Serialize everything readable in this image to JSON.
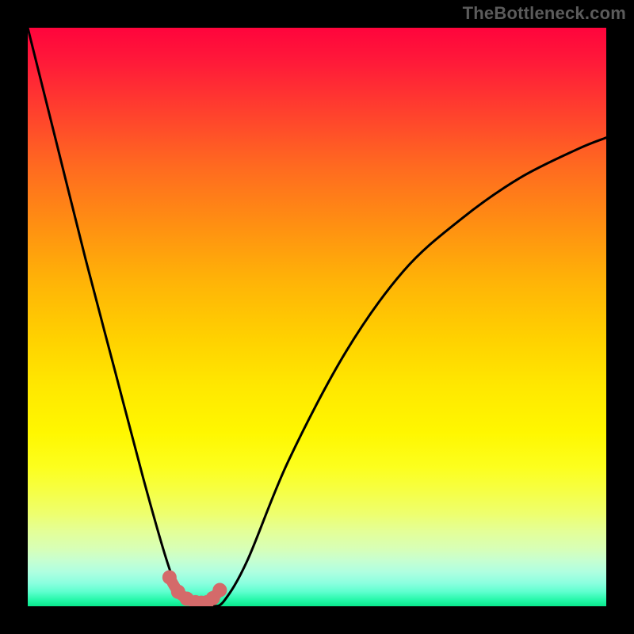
{
  "attribution": "TheBottleneck.com",
  "chart_data": {
    "type": "line",
    "title": "",
    "xlabel": "",
    "ylabel": "",
    "xlim": [
      0,
      100
    ],
    "ylim": [
      0,
      100
    ],
    "series": [
      {
        "name": "bottleneck-curve",
        "x": [
          0,
          5,
          10,
          15,
          20,
          24,
          26,
          28,
          30,
          32,
          34,
          38,
          45,
          55,
          65,
          75,
          85,
          95,
          100
        ],
        "values": [
          100,
          80,
          60,
          41,
          22,
          8,
          3,
          1,
          0,
          0,
          1,
          8,
          25,
          44,
          58,
          67,
          74,
          79,
          81
        ]
      }
    ],
    "highlight": {
      "name": "minimum-region",
      "x": [
        24.5,
        26,
        27.5,
        29,
        30,
        31,
        32,
        33.2
      ],
      "values": [
        5.0,
        2.5,
        1.3,
        0.7,
        0.6,
        0.7,
        1.4,
        2.8
      ]
    },
    "gradient_stops": [
      {
        "pos": 0.0,
        "color": "#ff043c"
      },
      {
        "pos": 0.3,
        "color": "#ff8f12"
      },
      {
        "pos": 0.62,
        "color": "#ffe800"
      },
      {
        "pos": 0.88,
        "color": "#d8ffb6"
      },
      {
        "pos": 1.0,
        "color": "#09e88c"
      }
    ]
  }
}
